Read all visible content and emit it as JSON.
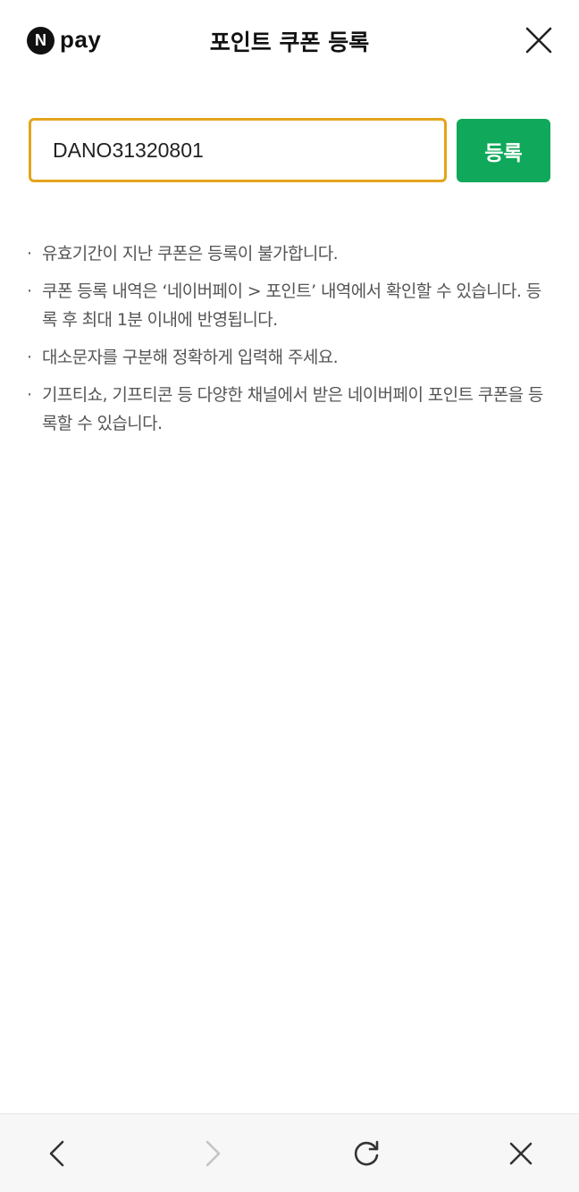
{
  "header": {
    "logo_mark": "N",
    "logo_text": "pay",
    "title": "포인트 쿠폰 등록",
    "close_icon": "close-icon"
  },
  "form": {
    "coupon_value": "DANO31320801",
    "register_label": "등록",
    "accent_color": "#e3a41c",
    "button_color": "#10a85a"
  },
  "notices": [
    "유효기간이 지난 쿠폰은 등록이 불가합니다.",
    "쿠폰 등록 내역은 ‘네이버페이 > 포인트’ 내역에서 확인할 수 있습니다. 등록 후 최대 1분 이내에 반영됩니다.",
    "대소문자를 구분해 정확하게 입력해 주세요.",
    "기프티쇼, 기프티콘 등 다양한 채널에서 받은 네이버페이 포인트 쿠폰을 등록할 수 있습니다."
  ],
  "bullet": "·",
  "browser_bar": {
    "icons": [
      "back-icon",
      "forward-icon",
      "refresh-icon",
      "close-icon"
    ]
  }
}
